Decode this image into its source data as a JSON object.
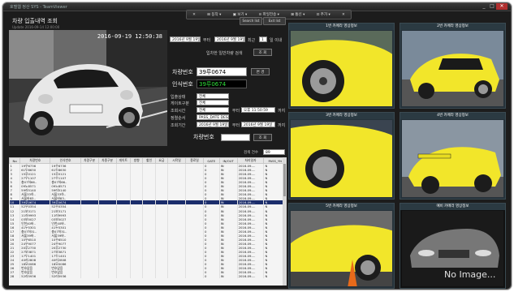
{
  "window": {
    "title": "호텔웹 정산 SYS - TeamViewer",
    "buttons": [
      "_",
      "□",
      "✕"
    ]
  },
  "menubar": {
    "items": [
      "✕",
      "⊞ 동작 ▾",
      "▣ 보기 ▾",
      "≡ 파일전송 ▾",
      "⊠ 통신 ▾",
      "⊡ 추가 ▾",
      "✕"
    ]
  },
  "app": {
    "title": "차량 입출내역 조회",
    "subtitle": "Update 2016-09-14 12:00:00",
    "btn_search_list": "Search list",
    "btn_exit": "Exit list"
  },
  "camera": {
    "timestamp": "2016-09-19 12:50:38"
  },
  "filters": {
    "date_from": "2016년 9월 19일",
    "date_to": "2016년 9월 19일",
    "hour_label": "부터",
    "days_value": "1",
    "days_label": "일 이내",
    "auto_label": "입차한 일반차량 검색",
    "search_btn": "조 회"
  },
  "plate": {
    "car_label": "차량번호",
    "car_value": "39루0674",
    "change_btn": "변 경",
    "recog_label": "인식번호",
    "recog_value": "39루0674"
  },
  "details": {
    "rows": [
      {
        "label": "입출상태",
        "value": "전체"
      },
      {
        "label": "게이트구분",
        "value": "전체"
      },
      {
        "label": "조회시간",
        "value": "전체"
      },
      {
        "label": "정렬순서",
        "value": "PASS_DATE DESC"
      },
      {
        "label": "조회기간",
        "value": "2016년 9월 19일"
      }
    ],
    "time_from_label": "부터",
    "time_from": "오후 11:50:59",
    "time_to_label": "까지",
    "period_label": "부터",
    "period_to": "2016년 9월 19일",
    "period_to_label": "까지",
    "bottom_label": "차량번호",
    "bottom_btn": "조 회",
    "count_label": "검색 건수",
    "count_value": "89"
  },
  "grid": {
    "columns": [
      "No",
      "차량번호",
      "인식번호",
      "차량구분",
      "차종구분",
      "게이트",
      "방향",
      "할인",
      "요금",
      "시작일",
      "종료일",
      "GATE",
      "IN/OUT",
      "처리일자",
      "PASS_YN"
    ],
    "rows": [
      [
        "1",
        "19우6736",
        "19우6736",
        "",
        "",
        "",
        "",
        "",
        "",
        "",
        "",
        "0",
        "IN",
        "2016-09-...",
        "N"
      ],
      [
        "2",
        "61두8630",
        "61두8630",
        "",
        "",
        "",
        "",
        "",
        "",
        "",
        "",
        "0",
        "IN",
        "2016-09-...",
        "N"
      ],
      [
        "3",
        "15루0121",
        "15루0121",
        "",
        "",
        "",
        "",
        "",
        "",
        "",
        "",
        "0",
        "IN",
        "2016-09-...",
        "N"
      ],
      [
        "4",
        "27우1107",
        "27우1107",
        "",
        "",
        "",
        "",
        "",
        "",
        "",
        "",
        "0",
        "IN",
        "2016-09-...",
        "N"
      ],
      [
        "5",
        "충07하66..",
        "충07하66..",
        "",
        "",
        "",
        "",
        "",
        "",
        "",
        "",
        "0",
        "IN",
        "2016-09-...",
        "N"
      ],
      [
        "6",
        "09노8571",
        "09노8571",
        "",
        "",
        "",
        "",
        "",
        "",
        "",
        "",
        "0",
        "IN",
        "2016-09-...",
        "N"
      ],
      [
        "7",
        "59러5140",
        "59러5140",
        "",
        "",
        "",
        "",
        "",
        "",
        "",
        "",
        "0",
        "IN",
        "2016-09-...",
        "N"
      ],
      [
        "8",
        "서울33하..",
        "서울33하..",
        "",
        "",
        "",
        "",
        "",
        "",
        "",
        "",
        "0",
        "IN",
        "2016-09-...",
        "N"
      ],
      [
        "9",
        "서울바83..",
        "서울바83..",
        "",
        "",
        "",
        "",
        "",
        "",
        "",
        "",
        "0",
        "IN",
        "2016-09-...",
        "N"
      ],
      [
        "10",
        "39루0674",
        "39루0674",
        "",
        "",
        "",
        "",
        "",
        "",
        "",
        "",
        "0",
        "IN",
        "2016-09-...",
        "N"
      ],
      [
        "11",
        "52우0354",
        "52우0354",
        "",
        "",
        "",
        "",
        "",
        "",
        "",
        "",
        "0",
        "IN",
        "2016-09-...",
        "N"
      ],
      [
        "12",
        "21보3171",
        "21보3171",
        "",
        "",
        "",
        "",
        "",
        "",
        "",
        "",
        "0",
        "IN",
        "2016-09-...",
        "N"
      ],
      [
        "13",
        "11러9993",
        "11러9993",
        "",
        "",
        "",
        "",
        "",
        "",
        "",
        "",
        "0",
        "IN",
        "2016-09-...",
        "N"
      ],
      [
        "14",
        "03보5027",
        "03보5027",
        "",
        "",
        "",
        "",
        "",
        "",
        "",
        "",
        "0",
        "IN",
        "2016-09-...",
        "N"
      ],
      [
        "15",
        "인천40바..",
        "인천40바..",
        "",
        "",
        "",
        "",
        "",
        "",
        "",
        "",
        "0",
        "IN",
        "2016-09-...",
        "N"
      ],
      [
        "16",
        "41두5301",
        "41두5301",
        "",
        "",
        "",
        "",
        "",
        "",
        "",
        "",
        "0",
        "IN",
        "2016-09-...",
        "N"
      ],
      [
        "17",
        "충07하31..",
        "충07하31..",
        "",
        "",
        "",
        "",
        "",
        "",
        "",
        "",
        "0",
        "IN",
        "2016-09-...",
        "N"
      ],
      [
        "18",
        "서울39바..",
        "서울39바..",
        "",
        "",
        "",
        "",
        "",
        "",
        "",
        "",
        "0",
        "IN",
        "2016-09-...",
        "N"
      ],
      [
        "19",
        "10우6510",
        "10우6510",
        "",
        "",
        "",
        "",
        "",
        "",
        "",
        "",
        "0",
        "IN",
        "2016-09-...",
        "N"
      ],
      [
        "20",
        "24우9077",
        "24우9077",
        "",
        "",
        "",
        "",
        "",
        "",
        "",
        "",
        "0",
        "IN",
        "2016-09-...",
        "N"
      ],
      [
        "21",
        "20루2730",
        "20루2730",
        "",
        "",
        "",
        "",
        "",
        "",
        "",
        "",
        "0",
        "IN",
        "2016-09-...",
        "N"
      ],
      [
        "22",
        "27보3871",
        "27보3871",
        "",
        "",
        "",
        "",
        "",
        "",
        "",
        "",
        "0",
        "IN",
        "2016-09-...",
        "N"
      ],
      [
        "23",
        "17두1401",
        "17두1401",
        "",
        "",
        "",
        "",
        "",
        "",
        "",
        "",
        "0",
        "IN",
        "2016-09-...",
        "N"
      ],
      [
        "24",
        "40러2808",
        "40러2808",
        "",
        "",
        "",
        "",
        "",
        "",
        "",
        "",
        "0",
        "IN",
        "2016-09-...",
        "N"
      ],
      [
        "25",
        "18모0086",
        "18모0086",
        "",
        "",
        "",
        "",
        "",
        "",
        "",
        "",
        "0",
        "IN",
        "2016-09-...",
        "N"
      ],
      [
        "26",
        "번호없음",
        "번호없음",
        "",
        "",
        "",
        "",
        "",
        "",
        "",
        "",
        "0",
        "IN",
        "2016-09-...",
        "N"
      ],
      [
        "27",
        "번호없음",
        "번호없음",
        "",
        "",
        "",
        "",
        "",
        "",
        "",
        "",
        "0",
        "IN",
        "2016-09-...",
        "N"
      ],
      [
        "28",
        "52러5936",
        "52러5936",
        "",
        "",
        "",
        "",
        "",
        "",
        "",
        "",
        "0",
        "IN",
        "2016-09-...",
        "N"
      ]
    ],
    "selected_row": 9
  },
  "thumbs": [
    {
      "caption": "1번 카메라 영상정보"
    },
    {
      "caption": "2번 카메라 영상정보"
    },
    {
      "caption": "3번 카메라 영상정보"
    },
    {
      "caption": "4번 카메라 영상정보"
    },
    {
      "caption": "5번 카메라 영상정보"
    },
    {
      "caption": "예비 카메라 영상정보",
      "placeholder": "No Image..."
    }
  ],
  "colors": {
    "car_yellow": "#f2e62a",
    "selected_row": "#1b2d6b",
    "recog_text": "#2fe03a"
  }
}
